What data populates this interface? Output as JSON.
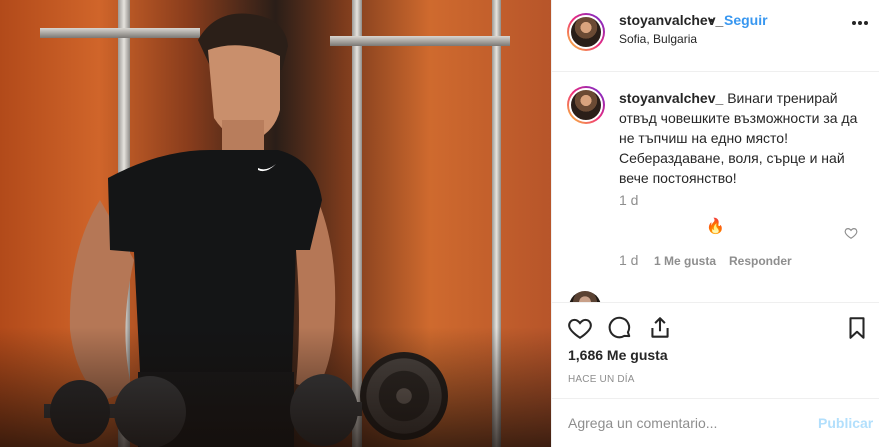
{
  "post": {
    "username": "stoyanvalchev_",
    "separator": "•",
    "follow_label": "Seguir",
    "location": "Sofia, Bulgaria",
    "caption": "Винаги тренирай отвъд човешките възможности за да не тъпчиш на едно място! Себераздаване, воля, сърце и най вече постоянство!",
    "caption_time": "1 d",
    "likes": "1,686 Me gusta",
    "posted_ago": "HACE UN DÍA"
  },
  "comment": {
    "text": "🔥",
    "time": "1 d",
    "likes_label": "1 Me gusta",
    "reply_label": "Responder"
  },
  "next_comment_peek": "",
  "composer": {
    "placeholder": "Agrega un comentario...",
    "publish_label": "Publicar"
  },
  "colors": {
    "link_blue": "#3897f0",
    "publish_disabled": "#b2dffc",
    "secondary_text": "#8e8e8e"
  },
  "icons": {
    "more": "more-options-icon",
    "like": "heart-icon",
    "comment": "comment-bubble-icon",
    "share": "share-icon",
    "save": "bookmark-icon"
  }
}
